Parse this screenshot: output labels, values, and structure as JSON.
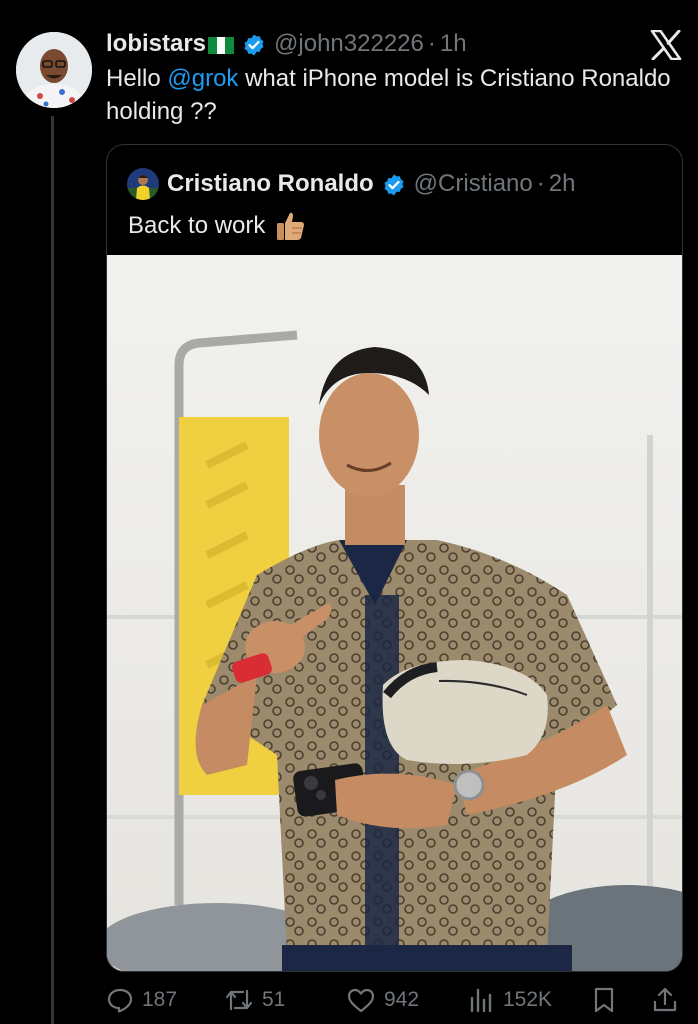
{
  "tweet": {
    "author_name": "lobistars",
    "author_handle": "@john322226",
    "time": "1h",
    "text_prefix": "Hello ",
    "mention": "@grok",
    "text_rest": " what iPhone model is Cristiano Ronaldo holding ??"
  },
  "quoted": {
    "author_name": "Cristiano Ronaldo",
    "author_handle": "@Cristiano",
    "time": "2h",
    "text": "Back to work"
  },
  "actions": {
    "replies": "187",
    "retweets": "51",
    "likes": "942",
    "views": "152K"
  },
  "icons": {
    "verified": "verified-badge-icon",
    "close": "x-logo-icon",
    "reply": "reply-icon",
    "retweet": "retweet-icon",
    "like": "heart-icon",
    "views": "views-icon",
    "bookmark": "bookmark-icon",
    "share": "share-icon"
  },
  "colors": {
    "background": "#000000",
    "text": "#e7e9ea",
    "muted": "#71767b",
    "accent": "#1d9bf0",
    "border": "#2f3336"
  }
}
